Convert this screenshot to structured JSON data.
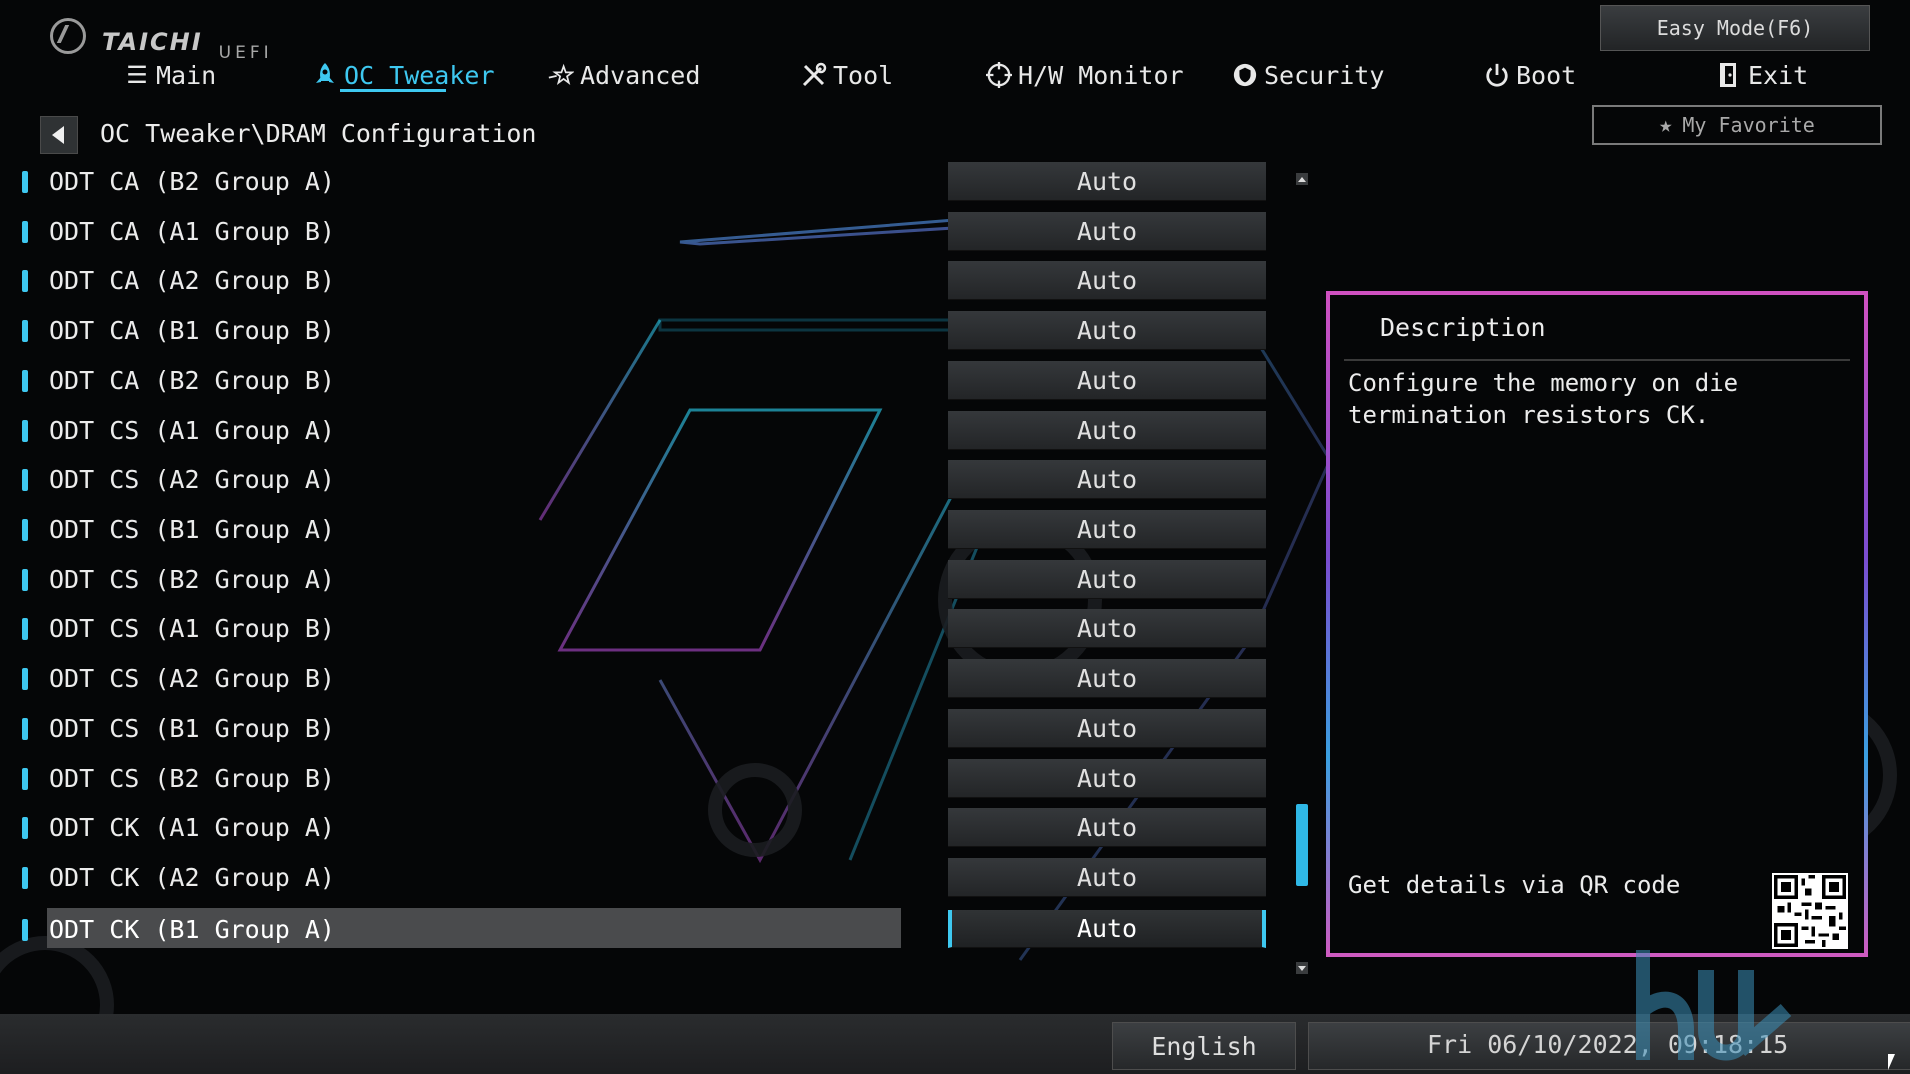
{
  "brand": {
    "name": "TAICHI",
    "sub": "UEFI"
  },
  "easy_mode_label": "Easy Mode(F6)",
  "nav": [
    {
      "label": "Main",
      "icon": "list-icon"
    },
    {
      "label": "OC Tweaker",
      "icon": "rocket-icon",
      "active": true
    },
    {
      "label": "Advanced",
      "icon": "star-swoosh-icon"
    },
    {
      "label": "Tool",
      "icon": "tools-icon"
    },
    {
      "label": "H/W Monitor",
      "icon": "crosshair-icon"
    },
    {
      "label": "Security",
      "icon": "shield-icon"
    },
    {
      "label": "Boot",
      "icon": "power-icon"
    },
    {
      "label": "Exit",
      "icon": "door-exit-icon"
    }
  ],
  "favorite_label": "My Favorite",
  "breadcrumb": "OC Tweaker\\DRAM Configuration",
  "settings": [
    {
      "label": "ODT CA (B2 Group A)",
      "value": "Auto"
    },
    {
      "label": "ODT CA (A1 Group B)",
      "value": "Auto"
    },
    {
      "label": "ODT CA (A2 Group B)",
      "value": "Auto"
    },
    {
      "label": "ODT CA (B1 Group B)",
      "value": "Auto"
    },
    {
      "label": "ODT CA (B2 Group B)",
      "value": "Auto"
    },
    {
      "label": "ODT CS (A1 Group A)",
      "value": "Auto"
    },
    {
      "label": "ODT CS (A2 Group A)",
      "value": "Auto"
    },
    {
      "label": "ODT CS (B1 Group A)",
      "value": "Auto"
    },
    {
      "label": "ODT CS (B2 Group A)",
      "value": "Auto"
    },
    {
      "label": "ODT CS (A1 Group B)",
      "value": "Auto"
    },
    {
      "label": "ODT CS (A2 Group B)",
      "value": "Auto"
    },
    {
      "label": "ODT CS (B1 Group B)",
      "value": "Auto"
    },
    {
      "label": "ODT CS (B2 Group B)",
      "value": "Auto"
    },
    {
      "label": "ODT CK (A1 Group A)",
      "value": "Auto"
    },
    {
      "label": "ODT CK (A2 Group A)",
      "value": "Auto"
    },
    {
      "label": "ODT CK (B1 Group A)",
      "value": "Auto",
      "selected": true
    }
  ],
  "description": {
    "title": "Description",
    "text": "Configure the memory on die termination resistors CK.",
    "qr_label": "Get details via QR code"
  },
  "footer": {
    "language": "English",
    "datetime": "Fri 06/10/2022, 09:18:15"
  },
  "colors": {
    "accent": "#3ec8f0",
    "panel_border": "#d050c0"
  }
}
